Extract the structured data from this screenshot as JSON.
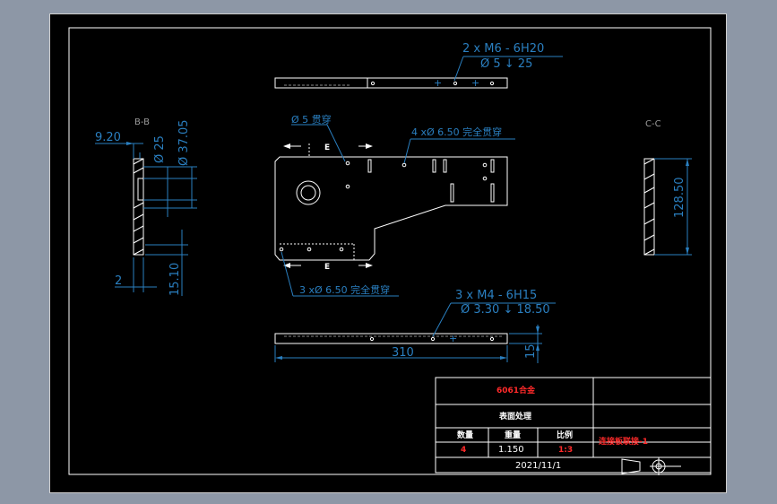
{
  "drawing": {
    "top_view": {
      "callout_line1": "2 x  M6 - 6H20",
      "callout_line2": "Ø 5  ↓ 25"
    },
    "front_view": {
      "hole_callout": "Ø 5 贯穿",
      "callout_top": "4 xØ  6.50 完全贯穿",
      "callout_bottom": "3 xØ  6.50 完全贯穿",
      "section_mark": "E"
    },
    "bottom_view": {
      "callout_line1": "3 x  M4 - 6H15",
      "callout_line2": "Ø  3.30 ↓ 18.50",
      "length_dim": "310",
      "height_dim": "15"
    },
    "section_bb": {
      "label": "B-B",
      "dim_920": "9.20",
      "dim_25": "Ø 25",
      "dim_3705": "Ø 37.05",
      "dim_2": "2",
      "dim_1510": "15.10"
    },
    "section_cc": {
      "label": "C-C",
      "dim_12850": "128.50"
    }
  },
  "title_block": {
    "material": "6061合金",
    "treatment": "表面处理",
    "qty_header": "数量",
    "weight_header": "重量",
    "scale_header": "比例",
    "qty_value": "4",
    "weight_value": "1.150",
    "scale_value": "1:3",
    "part_name": "连接板联接-1",
    "date": "2021/11/1"
  },
  "colors": {
    "background": "#8d97a6",
    "sheet": "#000000",
    "outline": "#ffffff",
    "dimension": "#2a7fc0",
    "label_red": "#ff2a2a"
  }
}
